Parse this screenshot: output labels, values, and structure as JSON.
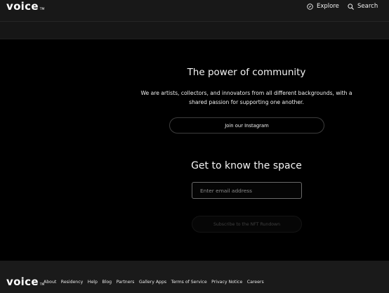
{
  "header": {
    "logo_text": "voice",
    "logo_tm": "TM",
    "nav": [
      {
        "label": "Explore",
        "icon": "compass-icon"
      },
      {
        "label": "Search",
        "icon": "search-icon"
      }
    ]
  },
  "community": {
    "title": "The power of community",
    "description": "We are artists, collectors, and innovators from all different backgrounds, with a shared passion for supporting one another.",
    "button_label": "Join our Instagram"
  },
  "newsletter": {
    "title": "Get to know the space",
    "email_placeholder": "Enter email address",
    "email_value": "",
    "subscribe_label": "Subscribe to the NFT Rundown"
  },
  "footer": {
    "logo_text": "voice",
    "logo_tm": "TM",
    "links": [
      "About",
      "Residency",
      "Help",
      "Blog",
      "Partners",
      "Gallery Apps",
      "Terms of Service",
      "Privacy Notice",
      "Careers"
    ]
  },
  "colors": {
    "background": "#000000",
    "header": "#181818",
    "footer": "#1a1a1a",
    "text": "#ffffff"
  }
}
